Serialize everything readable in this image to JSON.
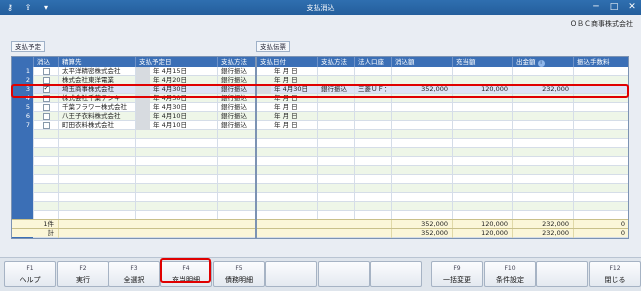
{
  "window": {
    "title": "支払消込",
    "company": "ＯＢＣ商事株式会社"
  },
  "toolbar_icons": [
    "key-plus-icon",
    "export-icon",
    "dropdown-icon"
  ],
  "left_tag": "支払予定",
  "right_tag": "支払伝票",
  "left_columns": [
    "消込",
    "精算先",
    "支払予定日",
    "支払方法"
  ],
  "right_columns": [
    "支払日付",
    "支払方法",
    "法人口座",
    "消込額",
    "充当額",
    "出金額",
    "振込手数料"
  ],
  "rows": [
    {
      "no": "1",
      "checked": false,
      "payee": "太平洋精密株式会社",
      "sched": "年  4月15日",
      "method": "銀行振込",
      "pay_date": "年    月    日",
      "pay_method": "",
      "account": "",
      "clear": "",
      "apply": "",
      "out": "",
      "fee": ""
    },
    {
      "no": "2",
      "checked": false,
      "payee": "株式会社東洋電業",
      "sched": "年  4月20日",
      "method": "銀行振込",
      "pay_date": "年    月    日",
      "pay_method": "",
      "account": "",
      "clear": "",
      "apply": "",
      "out": "",
      "fee": ""
    },
    {
      "no": "3",
      "checked": true,
      "payee": "埼玉商事株式会社",
      "sched": "年  4月30日",
      "method": "銀行振込",
      "pay_date": "年  4月30日",
      "pay_method": "銀行振込",
      "account": "三菱ＵＦ：",
      "clear": "352,000",
      "apply": "120,000",
      "out": "232,000",
      "fee": ""
    },
    {
      "no": "4",
      "checked": false,
      "payee": "株式会社千葉テンキ",
      "sched": "年  4月30日",
      "method": "銀行振込",
      "pay_date": "年    月    日",
      "pay_method": "",
      "account": "",
      "clear": "",
      "apply": "",
      "out": "",
      "fee": ""
    },
    {
      "no": "5",
      "checked": false,
      "payee": "千葉フラワー株式会社",
      "sched": "年  4月30日",
      "method": "銀行振込",
      "pay_date": "年    月    日",
      "pay_method": "",
      "account": "",
      "clear": "",
      "apply": "",
      "out": "",
      "fee": ""
    },
    {
      "no": "6",
      "checked": false,
      "payee": "八王子衣料株式会社",
      "sched": "年  4月10日",
      "method": "銀行振込",
      "pay_date": "年    月    日",
      "pay_method": "",
      "account": "",
      "clear": "",
      "apply": "",
      "out": "",
      "fee": ""
    },
    {
      "no": "7",
      "checked": false,
      "payee": "町田衣料株式会社",
      "sched": "年  4月10日",
      "method": "銀行振込",
      "pay_date": "年    月    日",
      "pay_method": "",
      "account": "",
      "clear": "",
      "apply": "",
      "out": "",
      "fee": ""
    }
  ],
  "totals": {
    "count_label": "1件",
    "sum_label": "計",
    "count": {
      "clear": "352,000",
      "apply": "120,000",
      "out": "232,000",
      "fee": "0"
    },
    "sum": {
      "clear": "352,000",
      "apply": "120,000",
      "out": "232,000",
      "fee": "0"
    }
  },
  "fkeys": [
    {
      "key": "F1",
      "label": "ヘルプ"
    },
    {
      "key": "F2",
      "label": "実行"
    },
    {
      "key": "F3",
      "label": "全選択"
    },
    {
      "key": "F4",
      "label": "充当明細"
    },
    {
      "key": "F5",
      "label": "債務明細"
    },
    {
      "key": "",
      "label": ""
    },
    {
      "key": "",
      "label": ""
    },
    {
      "key": "",
      "label": ""
    },
    {
      "key": "F9",
      "label": "一括変更"
    },
    {
      "key": "F10",
      "label": "条件設定"
    },
    {
      "key": "",
      "label": ""
    },
    {
      "key": "F12",
      "label": "閉じる"
    }
  ]
}
